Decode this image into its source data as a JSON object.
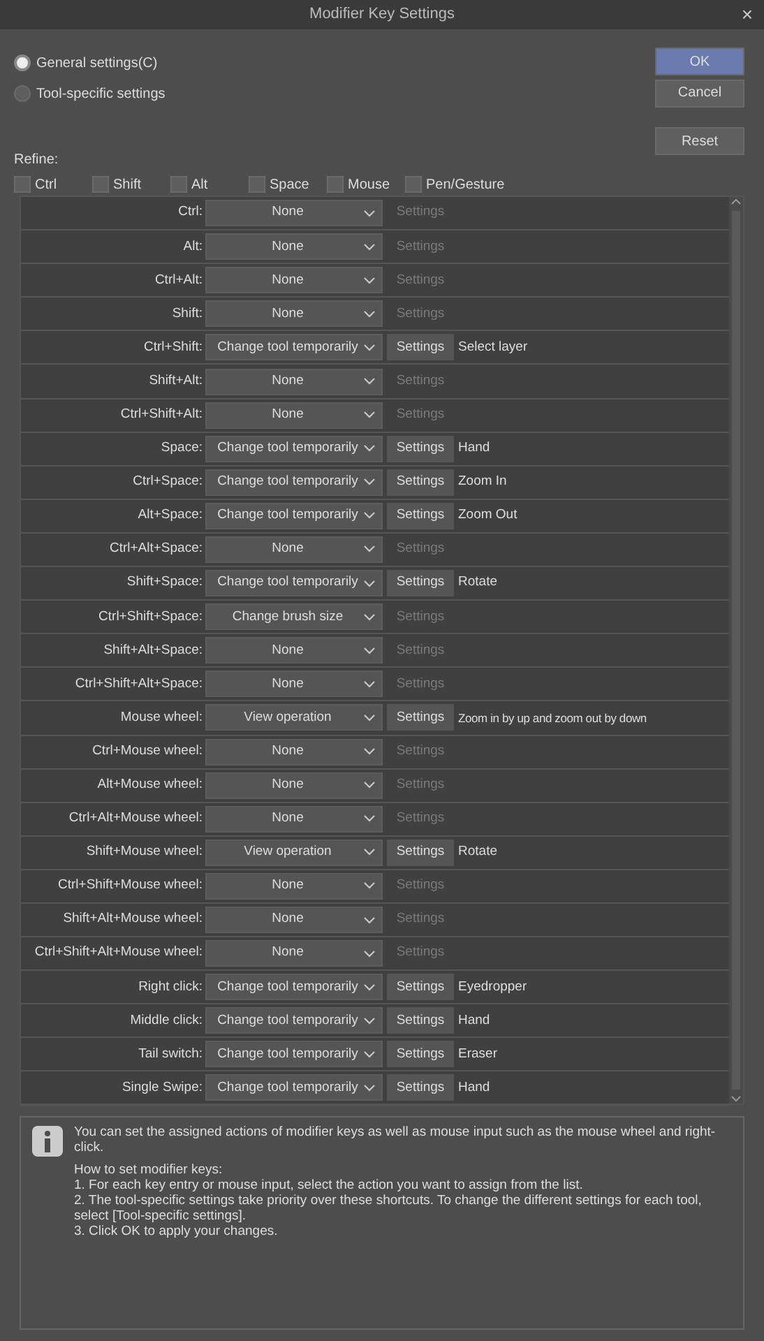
{
  "window": {
    "title": "Modifier Key Settings",
    "close": "×"
  },
  "modes": [
    {
      "label": "General settings(C)",
      "selected": true
    },
    {
      "label": "Tool-specific settings",
      "selected": false
    }
  ],
  "buttons": [
    {
      "label": "OK",
      "kind": "primary"
    },
    {
      "label": "Cancel",
      "kind": "normal"
    },
    {
      "label": "Reset",
      "kind": "spaced"
    }
  ],
  "refine": {
    "label": "Refine:",
    "filters": [
      {
        "label": "Ctrl",
        "checked": false
      },
      {
        "label": "Shift",
        "checked": false
      },
      {
        "label": "Alt",
        "checked": false
      },
      {
        "label": "Space",
        "checked": false
      },
      {
        "label": "Mouse",
        "checked": false
      },
      {
        "label": "Pen/Gesture",
        "checked": false
      }
    ]
  },
  "rows": [
    {
      "key": "Ctrl:",
      "action": "None",
      "settings": "Settings",
      "settings_enabled": false
    },
    {
      "key": "Alt:",
      "action": "None",
      "settings": "Settings",
      "settings_enabled": false
    },
    {
      "key": "Ctrl+Alt:",
      "action": "None",
      "settings": "Settings",
      "settings_enabled": false
    },
    {
      "key": "Shift:",
      "action": "None",
      "settings": "Settings",
      "settings_enabled": false
    },
    {
      "key": "Ctrl+Shift:",
      "action": "Change tool temporarily",
      "settings": "Settings",
      "settings_enabled": true,
      "detail": "Select layer"
    },
    {
      "key": "Shift+Alt:",
      "action": "None",
      "settings": "Settings",
      "settings_enabled": false
    },
    {
      "key": "Ctrl+Shift+Alt:",
      "action": "None",
      "settings": "Settings",
      "settings_enabled": false
    },
    {
      "key": "Space:",
      "action": "Change tool temporarily",
      "settings": "Settings",
      "settings_enabled": true,
      "detail": "Hand"
    },
    {
      "key": "Ctrl+Space:",
      "action": "Change tool temporarily",
      "settings": "Settings",
      "settings_enabled": true,
      "detail": "Zoom In"
    },
    {
      "key": "Alt+Space:",
      "action": "Change tool temporarily",
      "settings": "Settings",
      "settings_enabled": true,
      "detail": "Zoom Out"
    },
    {
      "key": "Ctrl+Alt+Space:",
      "action": "None",
      "settings": "Settings",
      "settings_enabled": false
    },
    {
      "key": "Shift+Space:",
      "action": "Change tool temporarily",
      "settings": "Settings",
      "settings_enabled": true,
      "detail": "Rotate"
    },
    {
      "key": "Ctrl+Shift+Space:",
      "action": "Change brush size",
      "settings": "Settings",
      "settings_enabled": false
    },
    {
      "key": "Shift+Alt+Space:",
      "action": "None",
      "settings": "Settings",
      "settings_enabled": false
    },
    {
      "key": "Ctrl+Shift+Alt+Space:",
      "action": "None",
      "settings": "Settings",
      "settings_enabled": false
    },
    {
      "key": "Mouse wheel:",
      "action": "View operation",
      "settings": "Settings",
      "settings_enabled": true,
      "detail": "Zoom in by up and zoom out by down"
    },
    {
      "key": "Ctrl+Mouse wheel:",
      "action": "None",
      "settings": "Settings",
      "settings_enabled": false
    },
    {
      "key": "Alt+Mouse wheel:",
      "action": "None",
      "settings": "Settings",
      "settings_enabled": false
    },
    {
      "key": "Ctrl+Alt+Mouse wheel:",
      "action": "None",
      "settings": "Settings",
      "settings_enabled": false
    },
    {
      "key": "Shift+Mouse wheel:",
      "action": "View operation",
      "settings": "Settings",
      "settings_enabled": true,
      "detail": "Rotate"
    },
    {
      "key": "Ctrl+Shift+Mouse wheel:",
      "action": "None",
      "settings": "Settings",
      "settings_enabled": false
    },
    {
      "key": "Shift+Alt+Mouse wheel:",
      "action": "None",
      "settings": "Settings",
      "settings_enabled": false
    },
    {
      "key": "Ctrl+Shift+Alt+Mouse wheel:",
      "action": "None",
      "settings": "Settings",
      "settings_enabled": false
    },
    {
      "key": "Right click:",
      "action": "Change tool temporarily",
      "settings": "Settings",
      "settings_enabled": true,
      "detail": "Eyedropper"
    },
    {
      "key": "Middle click:",
      "action": "Change tool temporarily",
      "settings": "Settings",
      "settings_enabled": true,
      "detail": "Hand"
    },
    {
      "key": "Tail switch:",
      "action": "Change tool temporarily",
      "settings": "Settings",
      "settings_enabled": true,
      "detail": "Eraser"
    },
    {
      "key": "Single Swipe:",
      "action": "Change tool temporarily",
      "settings": "Settings",
      "settings_enabled": true,
      "detail": "Hand"
    }
  ],
  "info": {
    "paragraphs": [
      "You can set the assigned actions of modifier keys as well as mouse input such as the mouse wheel and right-click.",
      "How to set modifier keys:\n1. For each key entry or mouse input, select the action you want to assign from the list.\n2. The tool-specific settings take priority over these shortcuts. To change the different settings for each tool, select [Tool-specific settings].\n3. Click OK to apply your changes."
    ]
  }
}
